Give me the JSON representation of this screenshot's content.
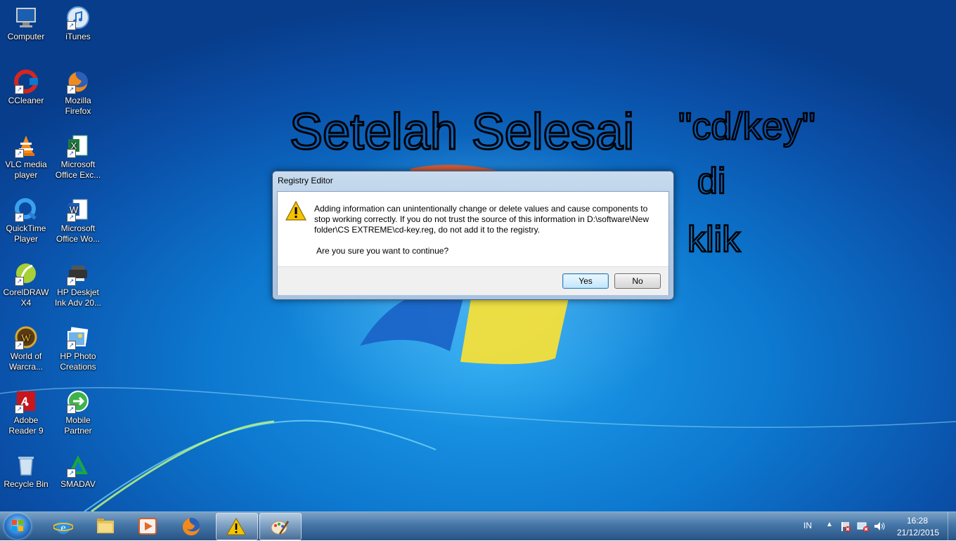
{
  "desktop_icons": [
    {
      "label": "Computer",
      "icon": "computer-icon"
    },
    {
      "label": "iTunes",
      "icon": "itunes-icon"
    },
    {
      "label": "CCleaner",
      "icon": "ccleaner-icon"
    },
    {
      "label": "Mozilla Firefox",
      "icon": "firefox-icon"
    },
    {
      "label": "VLC media player",
      "icon": "vlc-icon"
    },
    {
      "label": "Microsoft Office Exc...",
      "icon": "excel-icon"
    },
    {
      "label": "QuickTime Player",
      "icon": "quicktime-icon"
    },
    {
      "label": "Microsoft Office Wo...",
      "icon": "word-icon"
    },
    {
      "label": "CorelDRAW X4",
      "icon": "coreldraw-icon"
    },
    {
      "label": "HP Deskjet Ink Adv 20...",
      "icon": "printer-icon"
    },
    {
      "label": "World of Warcra...",
      "icon": "wow-icon"
    },
    {
      "label": "HP Photo Creations",
      "icon": "hp-photo-icon"
    },
    {
      "label": "Adobe Reader 9",
      "icon": "adobe-reader-icon"
    },
    {
      "label": "Mobile Partner",
      "icon": "mobile-partner-icon"
    },
    {
      "label": "Recycle Bin",
      "icon": "recycle-bin-icon"
    },
    {
      "label": "SMADAV",
      "icon": "smadav-icon"
    }
  ],
  "annotation": {
    "line1": "Setelah Selesai",
    "line2": "\"cd/key\"",
    "line3": "di",
    "line4": "klik"
  },
  "dialog": {
    "title": "Registry Editor",
    "message": "Adding information can unintentionally change or delete values and cause components to stop working correctly. If you do not trust the source of this information in D:\\software\\New folder\\CS EXTREME\\cd-key.reg, do not add it to the registry.",
    "question": "Are you sure you want to continue?",
    "yes_label": "Yes",
    "no_label": "No",
    "icon": "warning-icon"
  },
  "taskbar": {
    "apps": [
      "internet-explorer-icon",
      "file-explorer-icon",
      "media-player-icon",
      "firefox-icon",
      "warning-icon",
      "paint-icon"
    ],
    "language": "IN",
    "time": "16:28",
    "date": "21/12/2015"
  },
  "colors": {
    "desktop": "#0d78cf",
    "accent": "#3c7fb1",
    "warning": "#f5c400"
  }
}
